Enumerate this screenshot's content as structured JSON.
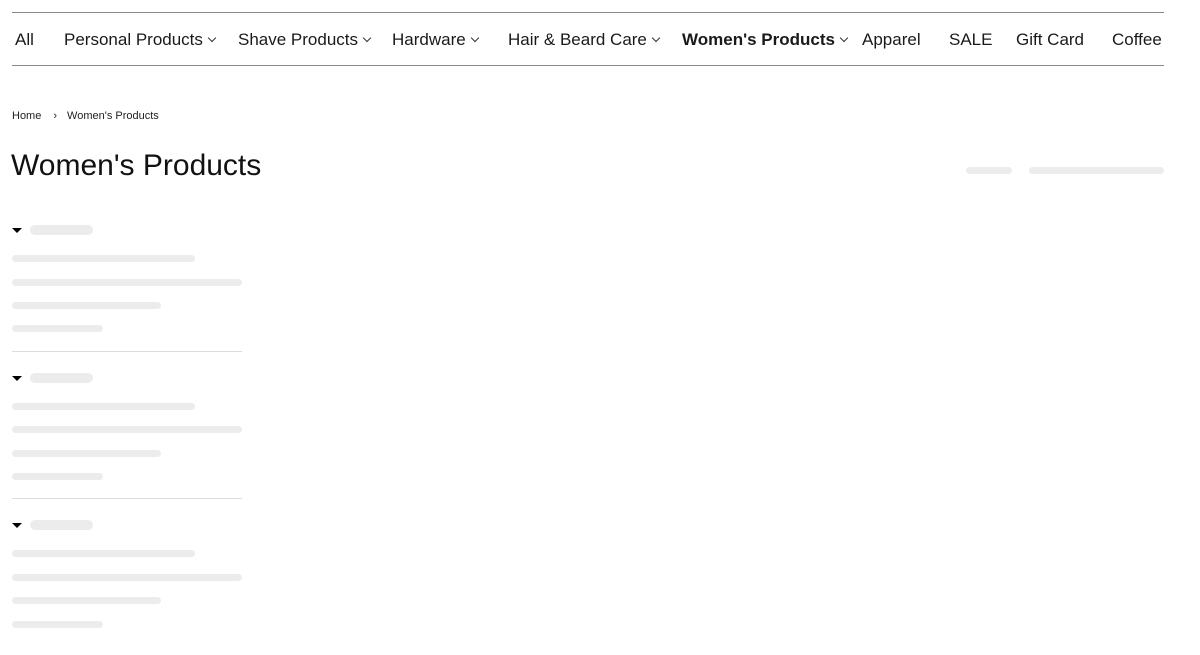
{
  "nav": {
    "items": [
      {
        "label": "All",
        "dropdown": false
      },
      {
        "label": "Personal Products",
        "dropdown": true
      },
      {
        "label": "Shave Products",
        "dropdown": true
      },
      {
        "label": "Hardware",
        "dropdown": true
      },
      {
        "label": "Hair & Beard Care",
        "dropdown": true
      },
      {
        "label": "Women's Products",
        "dropdown": true,
        "active": true
      },
      {
        "label": "Apparel",
        "dropdown": false
      },
      {
        "label": "SALE",
        "dropdown": false
      },
      {
        "label": "Gift Card",
        "dropdown": false
      },
      {
        "label": "Coffee",
        "dropdown": false
      }
    ]
  },
  "breadcrumb": {
    "home": "Home",
    "separator": "›",
    "current": "Women's Products"
  },
  "page": {
    "title": "Women's Products"
  },
  "filters": {
    "state": "loading",
    "groups_count": 3,
    "options_per_group": 4
  },
  "colors": {
    "skeleton": "#ececec",
    "divider": "#dcdcdc",
    "nav_border": "#8a8a8a"
  }
}
